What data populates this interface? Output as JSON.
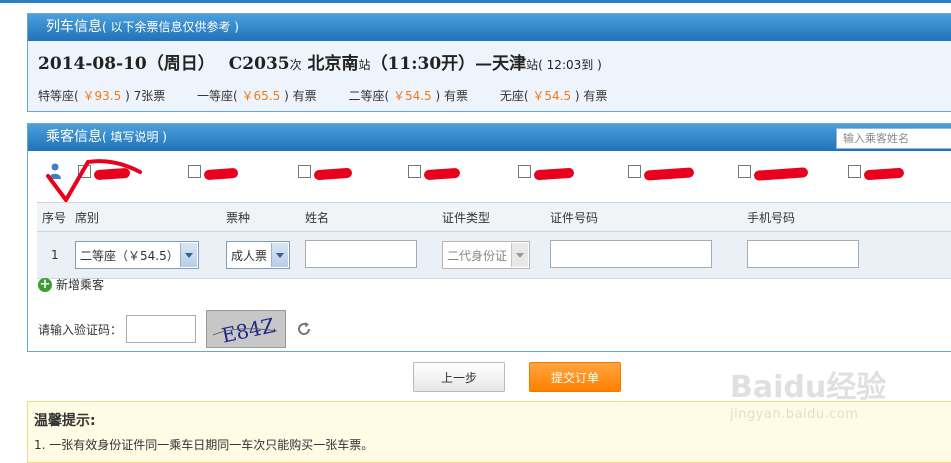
{
  "train_panel": {
    "header_title": "列车信息",
    "header_note": "( 以下余票信息仅供参考 )",
    "date": "2014-08-10",
    "weekday": "（周日）",
    "train_no": "C2035",
    "train_suffix": "次",
    "from_station": "北京南",
    "station_suffix": "站",
    "depart": "（11:30开）",
    "dash": "—",
    "to_station": "天津",
    "to_suffix": "站",
    "arrive": "( 12:03到 )",
    "seats": [
      {
        "name": "特等座",
        "price": "￥93.5",
        "avail": "7张票"
      },
      {
        "name": "一等座",
        "price": "￥65.5",
        "avail": "有票"
      },
      {
        "name": "二等座",
        "price": "￥54.5",
        "avail": "有票"
      },
      {
        "name": "无座",
        "price": "￥54.5",
        "avail": "有票"
      }
    ]
  },
  "passenger_panel": {
    "header_title": "乘客信息",
    "header_note": "( 填写说明 )",
    "search_placeholder": "输入乘客姓名",
    "columns": [
      "序号",
      "席别",
      "票种",
      "姓名",
      "证件类型",
      "证件号码",
      "手机号码"
    ],
    "row": {
      "index": "1",
      "seat_class": "二等座（￥54.5）",
      "ticket_type": "成人票",
      "id_type": "二代身份证"
    },
    "add_label": "新增乘客",
    "captcha_label": "请输入验证码：",
    "captcha_text": "E84Z"
  },
  "buttons": {
    "prev": "上一步",
    "submit": "提交订单"
  },
  "tips": {
    "title": "温馨提示:",
    "line1": "1. 一张有效身份证件同一乘车日期同一车次只能购买一张车票。"
  },
  "watermark": {
    "brand": "Baidu经验",
    "url": "jingyan.baidu.com"
  },
  "colors": {
    "header_blue": "#1f73b7",
    "price_orange": "#f07a1a",
    "submit_orange": "#ff8000",
    "redaction_red": "#e8001c"
  }
}
